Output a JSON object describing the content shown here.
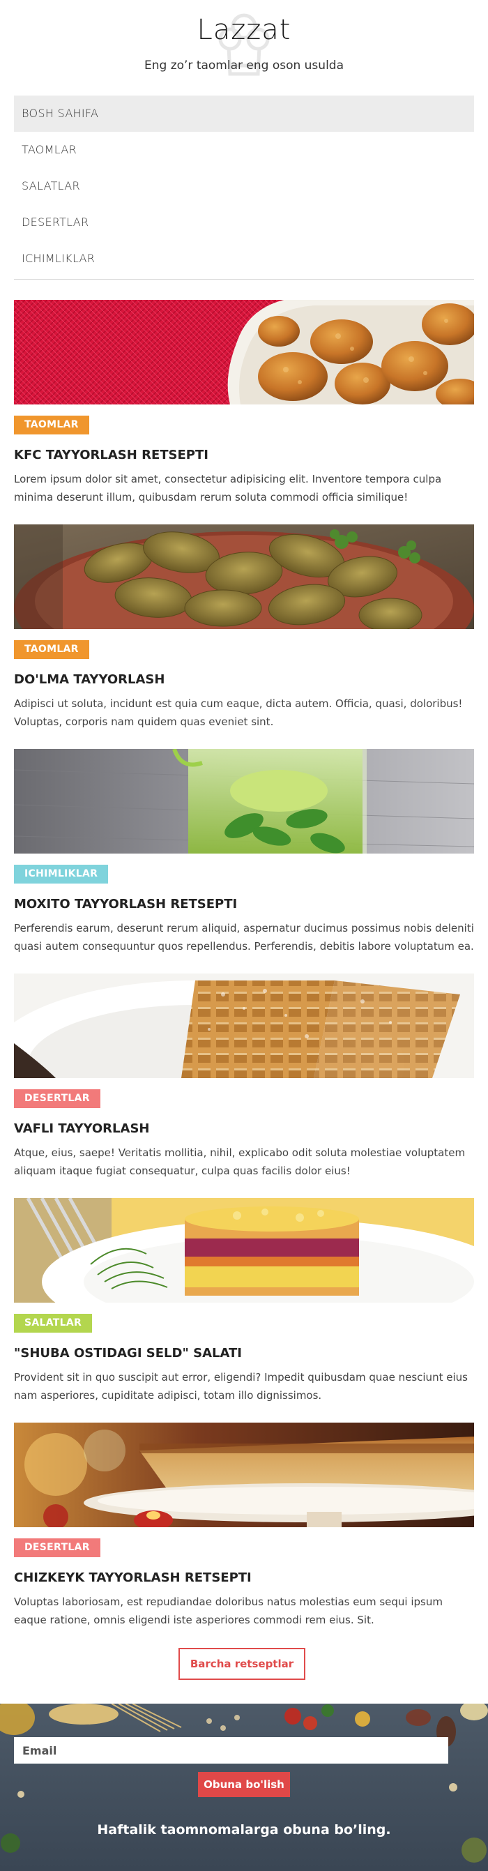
{
  "header": {
    "title": "Lazzat",
    "tagline": "Eng zo’r taomlar eng oson usulda"
  },
  "nav": {
    "items": [
      {
        "label": "BOSH SAHIFA"
      },
      {
        "label": "TAOMLAR"
      },
      {
        "label": "SALATLAR"
      },
      {
        "label": "DESERTLAR"
      },
      {
        "label": "ICHIMLIKLAR"
      }
    ],
    "active": "BOSH SAHIFA"
  },
  "posts": [
    {
      "category": "TAOMLAR",
      "category_color": "#f0962d",
      "image": "fried-chicken-photo",
      "title": "KFC TAYYORLASH RETSEPTI",
      "excerpt": "Lorem ipsum dolor sit amet, consectetur adipisicing elit. Inventore tempora culpa minima deserunt illum, quibusdam rerum soluta commodi officia similique!"
    },
    {
      "category": "TAOMLAR",
      "category_color": "#f0962d",
      "image": "dolma-photo",
      "title": "DO'LMA TAYYORLASH",
      "excerpt": "Adipisci ut soluta, incidunt est quia cum eaque, dicta autem. Officia, quasi, doloribus! Voluptas, corporis nam quidem quas eveniet sint."
    },
    {
      "category": "ICHIMLIKLAR",
      "category_color": "#7fd3dc",
      "image": "mojito-photo",
      "title": "MOXITO TAYYORLASH RETSEPTI",
      "excerpt": "Perferendis earum, deserunt rerum aliquid, aspernatur ducimus possimus nobis deleniti quasi autem consequuntur quos repellendus. Perferendis, debitis labore voluptatum ea."
    },
    {
      "category": "DESERTLAR",
      "category_color": "#f27a7a",
      "image": "waffle-photo",
      "title": "VAFLI TAYYORLASH",
      "excerpt": "Atque, eius, saepe! Veritatis mollitia, nihil, explicabo odit soluta molestiae voluptatem aliquam itaque fugiat consequatur, culpa quas facilis dolor eius!"
    },
    {
      "category": "SALATLAR",
      "category_color": "#b3d64e",
      "image": "shuba-salad-photo",
      "title": "\"SHUBA OSTIDAGI SELD\" SALATI",
      "excerpt": "Provident sit in quo suscipit aut error, eligendi? Impedit quibusdam quae nesciunt eius nam asperiores, cupiditate adipisci, totam illo dignissimos."
    },
    {
      "category": "DESERTLAR",
      "category_color": "#f27a7a",
      "image": "cheesecake-photo",
      "title": "CHIZKEYK TAYYORLASH RETSEPTI",
      "excerpt": "Voluptas laboriosam, est repudiandae doloribus natus molestias eum sequi ipsum eaque ratione, omnis eligendi iste asperiores commodi rem eius. Sit."
    }
  ],
  "all_recipes_label": "Barcha retseptlar",
  "subscribe": {
    "email_placeholder": "Email",
    "button_label": "Obuna bo'lish",
    "text": "Haftalik taomnomalarga obuna bo’ling."
  },
  "colors": {
    "accent": "#e04848",
    "nav_active_bg": "#ececec"
  }
}
